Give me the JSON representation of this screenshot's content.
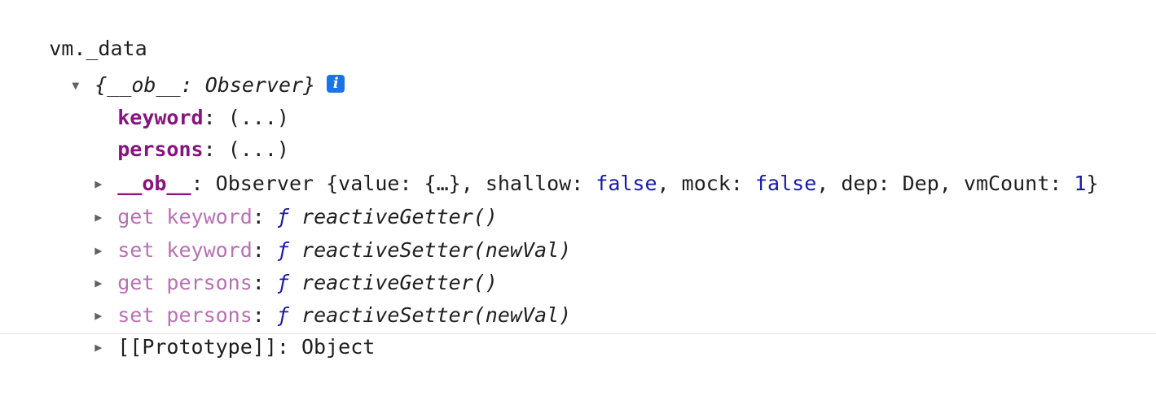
{
  "expression": "vm._data",
  "root": {
    "toggle": "▼",
    "summary_open": "{",
    "summary_key": "__ob__",
    "summary_sep": ": ",
    "summary_value": "Observer",
    "summary_close": "}",
    "info_icon_glyph": "i"
  },
  "properties": [
    {
      "key": "keyword",
      "sep": ": ",
      "value": "(...)"
    },
    {
      "key": "persons",
      "sep": ": ",
      "value": "(...)"
    }
  ],
  "ob_row": {
    "toggle": "▶",
    "key": "__ob__",
    "sep": ": ",
    "class_name": "Observer ",
    "brace_open": "{",
    "f1_key": "value",
    "f1_val": "{…}",
    "f2_key": "shallow",
    "f2_val": "false",
    "f3_key": "mock",
    "f3_val": "false",
    "f4_key": "dep",
    "f4_val": "Dep",
    "f5_key": "vmCount",
    "f5_val": "1",
    "comma": ", ",
    "colon": ": ",
    "brace_close": "}"
  },
  "accessors": [
    {
      "toggle": "▶",
      "key": "get keyword",
      "sep": ": ",
      "fsym": "ƒ",
      "fn": "reactiveGetter()"
    },
    {
      "toggle": "▶",
      "key": "set keyword",
      "sep": ": ",
      "fsym": "ƒ",
      "fn": "reactiveSetter(newVal)"
    },
    {
      "toggle": "▶",
      "key": "get persons",
      "sep": ": ",
      "fsym": "ƒ",
      "fn": "reactiveGetter()"
    },
    {
      "toggle": "▶",
      "key": "set persons",
      "sep": ": ",
      "fsym": "ƒ",
      "fn": "reactiveSetter(newVal)"
    }
  ],
  "prototype_row": {
    "toggle": "▶",
    "key": "[[Prototype]]",
    "sep": ": ",
    "value": "Object"
  },
  "colors": {
    "own_key": "#881280",
    "inherited_key": "#b871b3",
    "keyword_value": "#1a1aa6",
    "info_badge": "#1a73e8"
  }
}
